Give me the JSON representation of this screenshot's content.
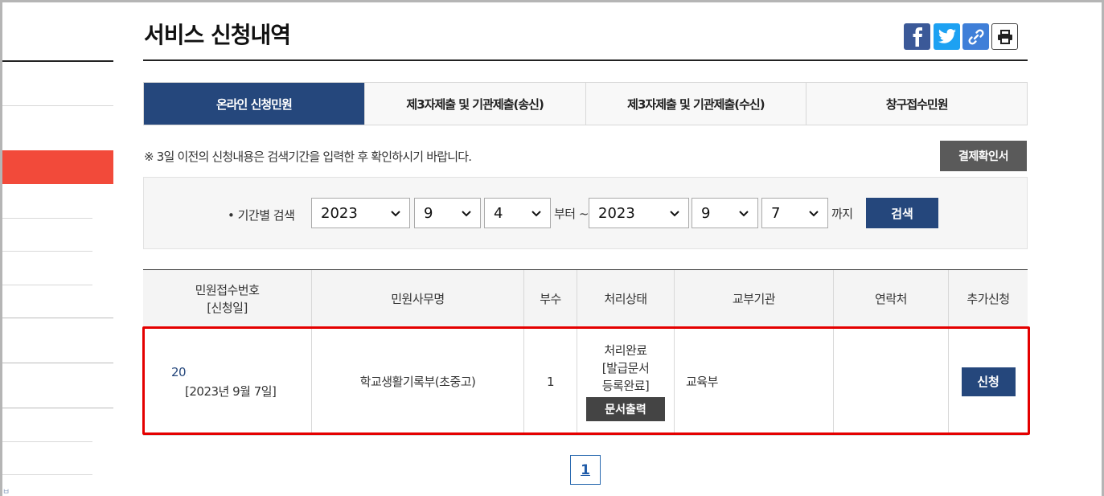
{
  "page": {
    "title": "서비스 신청내역"
  },
  "share": {
    "facebook": "facebook-icon",
    "twitter": "twitter-icon",
    "link": "link-icon",
    "print": "print-icon"
  },
  "sidebar": {
    "fragment_text": "ㅂ"
  },
  "tabs": [
    {
      "label": "온라인 신청민원",
      "active": true
    },
    {
      "label": "제3자제출 및 기관제출(송신)",
      "active": false
    },
    {
      "label": "제3자제출 및 기관제출(수신)",
      "active": false
    },
    {
      "label": "창구접수민원",
      "active": false
    }
  ],
  "notice": "※ 3일 이전의 신청내용은 검색기간을 입력한 후 확인하시기 바랍니다.",
  "payment_button": "결제확인서",
  "search": {
    "label": "• 기간별 검색",
    "from_year": "2023",
    "from_month": "9",
    "from_day": "4",
    "from_word": "부터 ~",
    "to_year": "2023",
    "to_month": "9",
    "to_day": "7",
    "to_word": "까지",
    "button": "검색"
  },
  "table": {
    "headers": {
      "receipt_line1": "민원접수번호",
      "receipt_line2": "[신청일]",
      "name": "민원사무명",
      "copies": "부수",
      "status": "처리상태",
      "issuer": "교부기관",
      "contact": "연락처",
      "extra": "추가신청"
    },
    "rows": [
      {
        "receipt_no": "20:",
        "date": "[2023년 9월 7일]",
        "name": "학교생활기록부(초중고)",
        "copies": "1",
        "status_line1": "처리완료",
        "status_line2": "[발급문서",
        "status_line3": "등록완료]",
        "print_button": "문서출력",
        "issuer": "교육부",
        "contact": "",
        "apply_button": "신청"
      }
    ]
  },
  "pagination": {
    "current": "1"
  },
  "colors": {
    "primary": "#25477c",
    "highlight": "#e40000",
    "sidebar_active": "#f24a3a"
  }
}
